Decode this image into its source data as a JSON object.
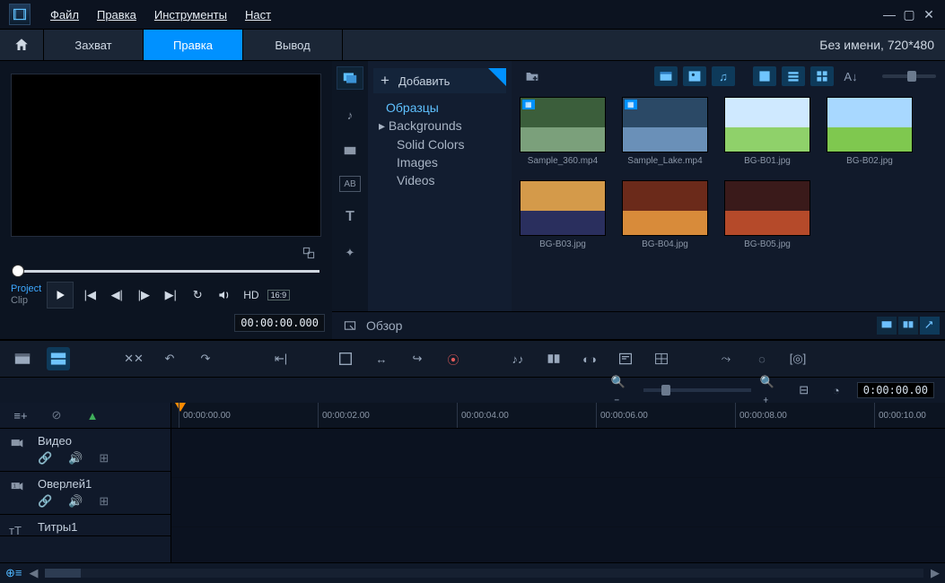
{
  "menu": {
    "file": "Файл",
    "edit": "Правка",
    "tools": "Инструменты",
    "settings": "Наст"
  },
  "modes": {
    "capture": "Захват",
    "edit": "Правка",
    "output": "Вывод"
  },
  "project_title": "Без имени, 720*480",
  "preview": {
    "project": "Project",
    "clip": "Clip",
    "hd": "HD",
    "aspect": "16:9",
    "timecode": "00:00:00.000"
  },
  "library": {
    "add": "Добавить",
    "tree": {
      "samples": "Образцы",
      "backgrounds": "Backgrounds",
      "solid": "Solid Colors",
      "images": "Images",
      "videos": "Videos"
    },
    "overview": "Обзор",
    "items": [
      {
        "name": "Sample_360.mp4",
        "type": "vid",
        "c1": "#7ba07b",
        "c2": "#3b5e3b"
      },
      {
        "name": "Sample_Lake.mp4",
        "type": "vid",
        "c1": "#6a90b8",
        "c2": "#2b4966"
      },
      {
        "name": "BG-B01.jpg",
        "type": "img",
        "c1": "#8fd16a",
        "c2": "#cfe9ff"
      },
      {
        "name": "BG-B02.jpg",
        "type": "img",
        "c1": "#7fc84f",
        "c2": "#a8d8ff"
      },
      {
        "name": "BG-B03.jpg",
        "type": "img",
        "c1": "#2a2f5e",
        "c2": "#d49a4a"
      },
      {
        "name": "BG-B04.jpg",
        "type": "img",
        "c1": "#d88b3a",
        "c2": "#6b2a1a"
      },
      {
        "name": "BG-B05.jpg",
        "type": "img",
        "c1": "#b54a2a",
        "c2": "#3a1a1a"
      }
    ]
  },
  "timeline": {
    "tc": "0:00:00.00",
    "marks": [
      "00:00:00.00",
      "00:00:02.00",
      "00:00:04.00",
      "00:00:06.00",
      "00:00:08.00",
      "00:00:10.00"
    ],
    "tracks": {
      "video": "Видео",
      "overlay": "Оверлей1",
      "title": "Титры1"
    }
  }
}
